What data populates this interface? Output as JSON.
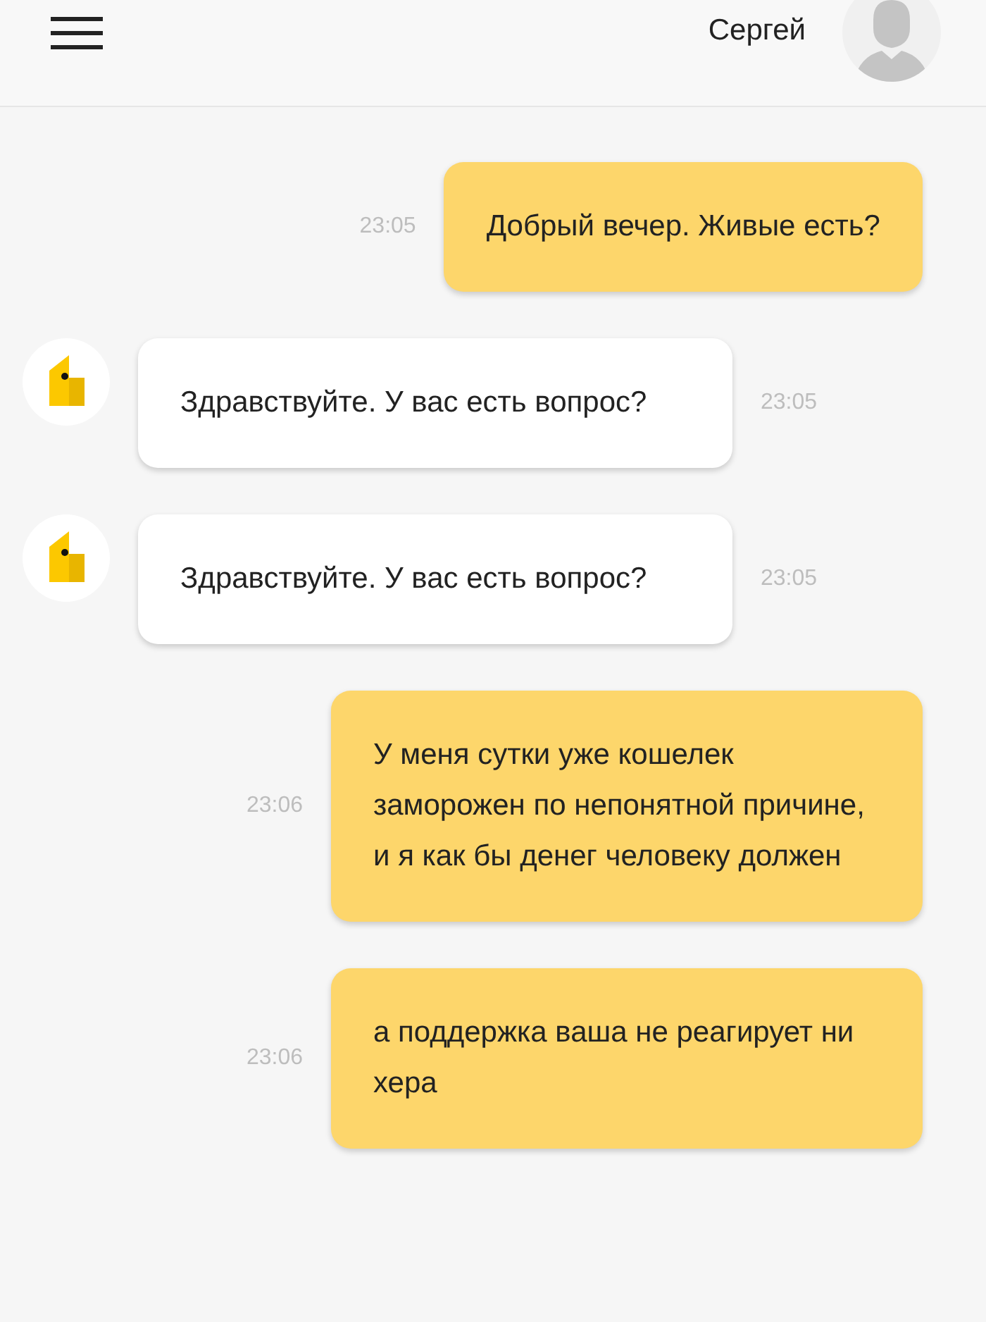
{
  "header": {
    "user_name": "Сергей"
  },
  "messages": [
    {
      "kind": "outgoing",
      "text": "Добрый вечер. Живые есть?",
      "time": "23:05"
    },
    {
      "kind": "incoming",
      "text": "Здравствуйте. У вас есть вопрос?",
      "time": "23:05"
    },
    {
      "kind": "incoming",
      "text": "Здравствуйте. У вас есть вопрос?",
      "time": "23:05"
    },
    {
      "kind": "outgoing",
      "text": "У меня сутки уже кошелек заморожен по непонятной причине, и я как бы денег человеку должен",
      "time": "23:06"
    },
    {
      "kind": "outgoing",
      "text": "а поддержка ваша не реагирует ни хера",
      "time": "23:06"
    }
  ]
}
